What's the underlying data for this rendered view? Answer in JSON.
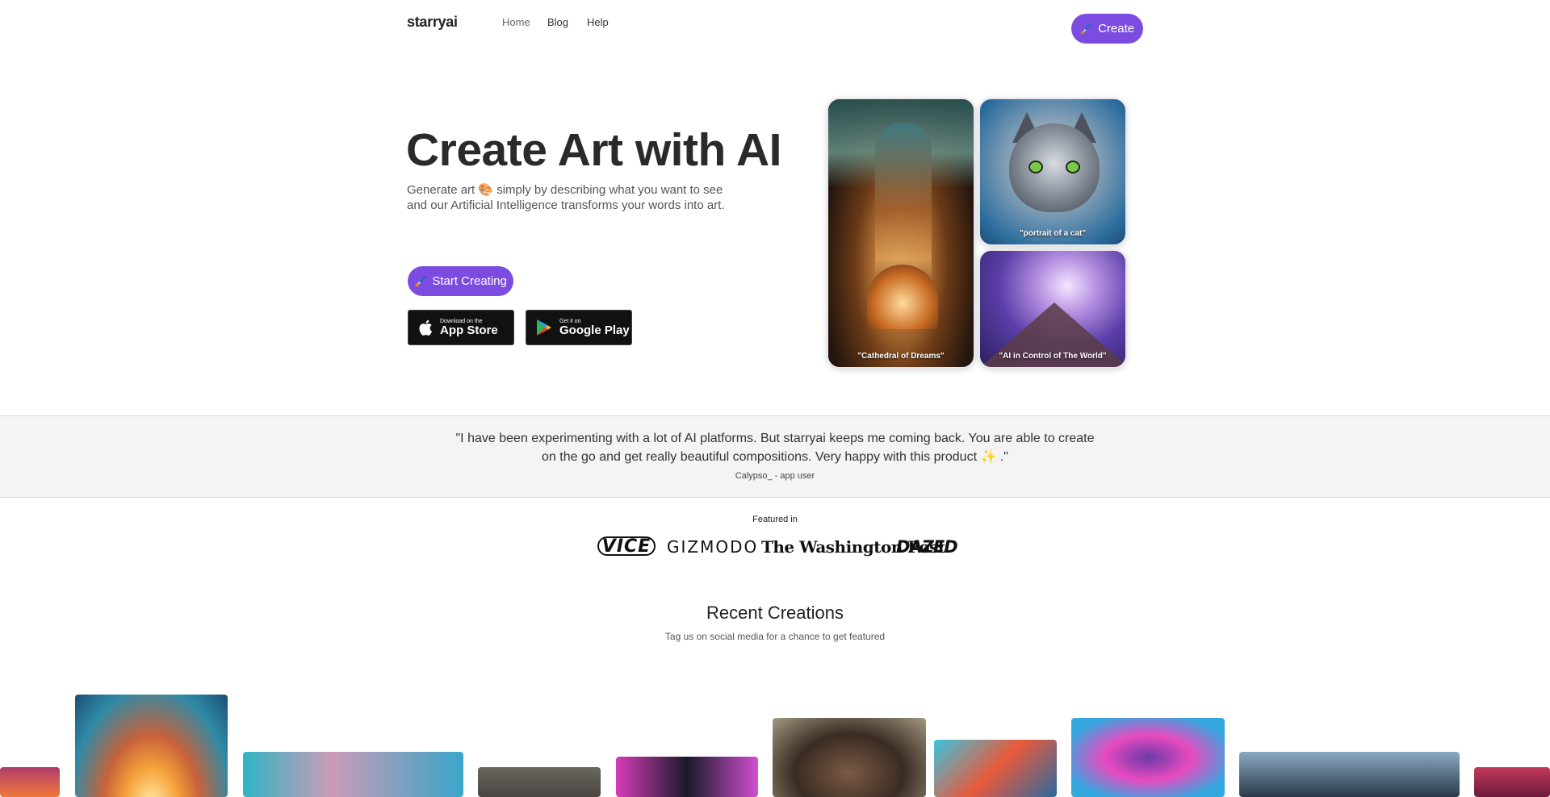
{
  "nav": {
    "logo": "starryai",
    "links": [
      "Home",
      "Blog",
      "Help"
    ],
    "create_label": "Create"
  },
  "hero": {
    "title": "Create Art with AI",
    "desc_line1": "Generate art 🎨 simply by describing what you want to see",
    "desc_line2": "and our Artificial Intelligence transforms your words into art.",
    "start_label": "Start Creating",
    "app_store": {
      "small": "Download on the",
      "big": "App Store"
    },
    "google_play": {
      "small": "Get it on",
      "big": "Google Play"
    }
  },
  "art": {
    "captions": [
      "\"Cathedral of Dreams\"",
      "\"portrait of a cat\"",
      "\"AI in Control of The World\""
    ]
  },
  "testimonial": {
    "quote_line1": "\"I have been experimenting with a lot of AI platforms. But starryai keeps me coming back. You are able to create",
    "quote_line2": "on the go and get really beautiful compositions. Very happy with this product ✨ .\"",
    "author": "Calypso_ - app user"
  },
  "featured": {
    "label": "Featured in",
    "logos": [
      "VICE",
      "GIZMODO",
      "The Washington Post",
      "DAZED"
    ]
  },
  "recent": {
    "title": "Recent Creations",
    "subtitle": "Tag us on social media for a chance to get featured"
  },
  "colors": {
    "accent": "#7c4ce0",
    "testimonial_bg": "#f4f4f4"
  }
}
